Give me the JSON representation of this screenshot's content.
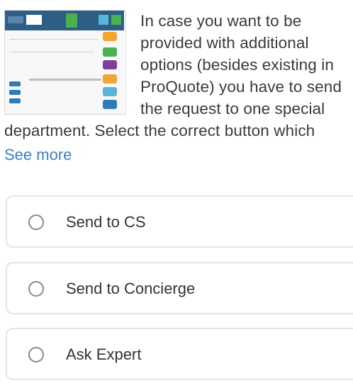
{
  "question": {
    "lines_beside_image": [
      "In case you want to be",
      "provided with additional",
      "options (besides existing in",
      "ProQuote) you have to send",
      "the request to one special"
    ],
    "lines_full_width": [
      "department. Select the correct button which"
    ],
    "see_more_label": "See more",
    "image_icon": "screenshot-thumbnail"
  },
  "options": [
    {
      "label": "Send to CS",
      "selected": false
    },
    {
      "label": "Send to Concierge",
      "selected": false
    },
    {
      "label": "Ask Expert",
      "selected": false
    }
  ],
  "colors": {
    "text": "#3a3a3a",
    "link": "#3c7fc3",
    "option_border": "#e5e5e5",
    "radio_border": "#8a8a8a"
  }
}
